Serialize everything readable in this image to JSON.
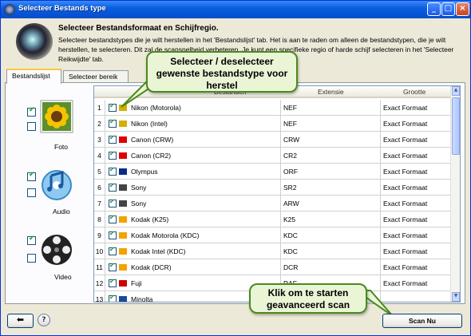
{
  "window": {
    "title": "Selecteer Bestands type"
  },
  "header": {
    "title": "Selecteer Bestandsformaat en Schijfregio.",
    "description": "Selecteer bestandstypes die je wilt herstellen in het 'Bestandslijst' tab. Het is aan te raden om alleen de bestandstypen, die je wilt herstellen, te selecteren. Dit zal de scansnelheid verbeteren. Je kunt een specifieke regio of harde schijf selecteren in het 'Selecteer Reikwijdte' tab."
  },
  "tabs": [
    {
      "label": "Bestandslijst"
    },
    {
      "label": "Selecteer bereik"
    }
  ],
  "categories": [
    {
      "label": "Foto"
    },
    {
      "label": "Audio"
    },
    {
      "label": "Video"
    }
  ],
  "table": {
    "columns": {
      "name": "Bestanden",
      "ext": "Extensie",
      "size": "Grootte"
    },
    "rows": [
      {
        "num": "1",
        "name": "Nikon (Motorola)",
        "ext": "NEF",
        "size": "Exact Formaat"
      },
      {
        "num": "2",
        "name": "Nikon (Intel)",
        "ext": "NEF",
        "size": "Exact Formaat"
      },
      {
        "num": "3",
        "name": "Canon (CRW)",
        "ext": "CRW",
        "size": "Exact Formaat"
      },
      {
        "num": "4",
        "name": "Canon (CR2)",
        "ext": "CR2",
        "size": "Exact Formaat"
      },
      {
        "num": "5",
        "name": "Olympus",
        "ext": "ORF",
        "size": "Exact Formaat"
      },
      {
        "num": "6",
        "name": "Sony",
        "ext": "SR2",
        "size": "Exact Formaat"
      },
      {
        "num": "7",
        "name": "Sony",
        "ext": "ARW",
        "size": "Exact Formaat"
      },
      {
        "num": "8",
        "name": "Kodak (K25)",
        "ext": "K25",
        "size": "Exact Formaat"
      },
      {
        "num": "9",
        "name": "Kodak Motorola (KDC)",
        "ext": "KDC",
        "size": "Exact Formaat"
      },
      {
        "num": "10",
        "name": "Kodak Intel (KDC)",
        "ext": "KDC",
        "size": "Exact Formaat"
      },
      {
        "num": "11",
        "name": "Kodak (DCR)",
        "ext": "DCR",
        "size": "Exact Formaat"
      },
      {
        "num": "12",
        "name": "Fuji",
        "ext": "RAF",
        "size": "Exact Formaat"
      },
      {
        "num": "13",
        "name": "Minolta",
        "ext": "",
        "size": ""
      }
    ]
  },
  "callouts": {
    "top": "Selecteer / deselecteer gewenste bestandstype voor herstel",
    "bottom": "Klik om te starten geavanceerd scan"
  },
  "buttons": {
    "scan": "Scan Nu",
    "help": "?"
  }
}
